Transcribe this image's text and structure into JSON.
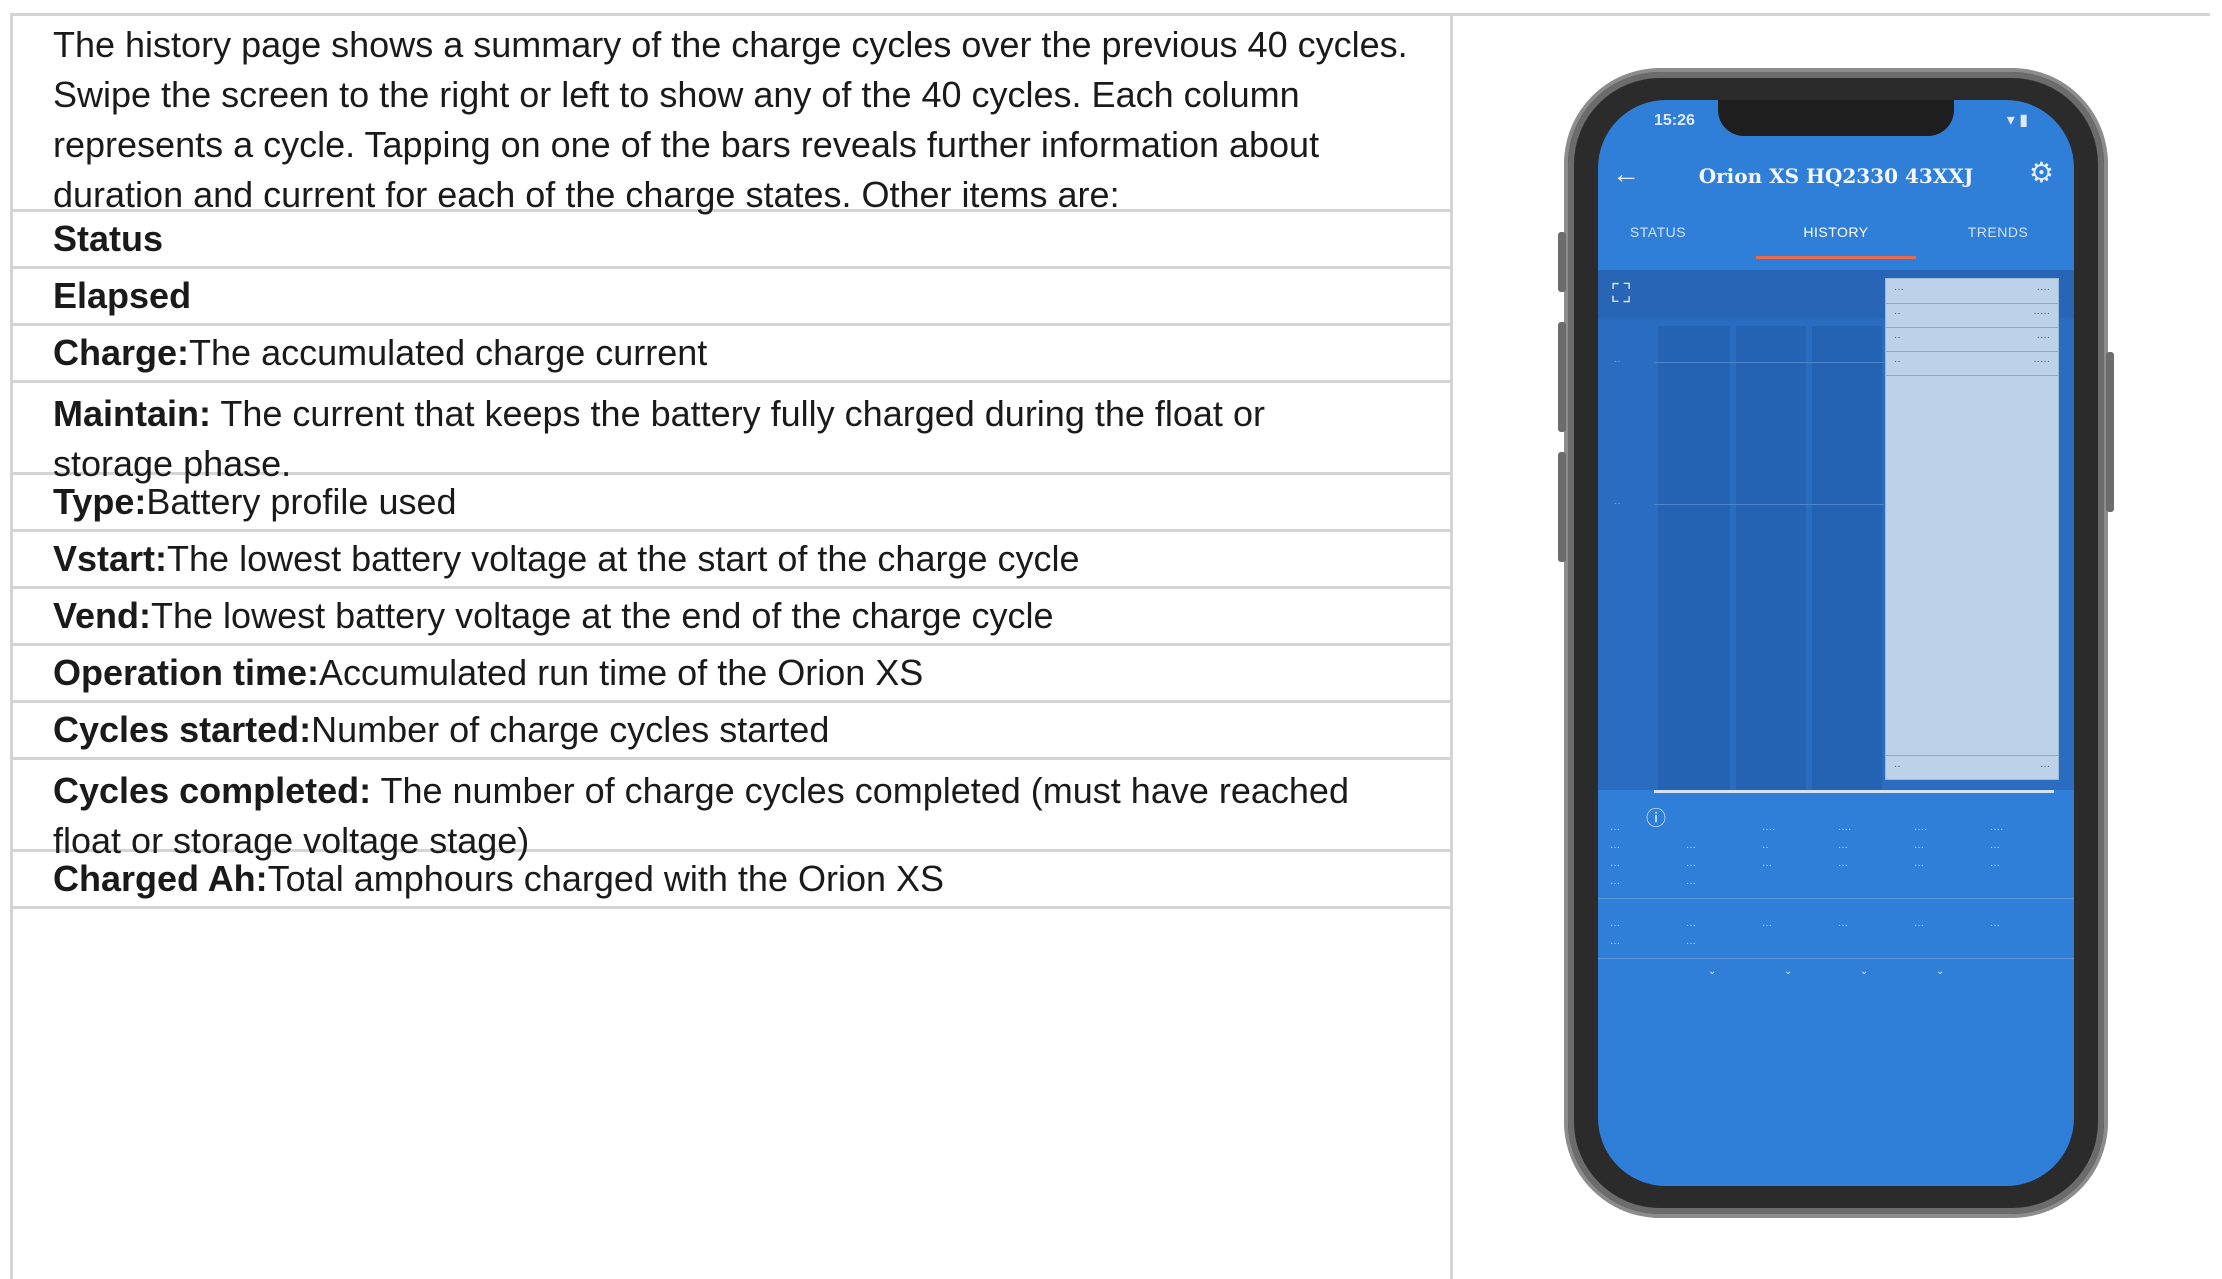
{
  "intro": "The history page shows a summary of the charge cycles over the previous 40 cycles. Swipe the screen to the right or left to show any of the 40 cycles. Each column represents a cycle. Tapping on one of the bars reveals further information about duration and current for each of the charge states. Other items are:",
  "items": [
    {
      "term": "Status",
      "desc": ""
    },
    {
      "term": "Elapsed",
      "desc": ""
    },
    {
      "term": "Charge:",
      "desc": " The accumulated charge current"
    },
    {
      "term": "Maintain:",
      "desc": " The current that keeps the battery fully charged during the float or storage phase."
    },
    {
      "term": "Type:",
      "desc": " Battery profile used"
    },
    {
      "term": "Vstart:",
      "desc": " The lowest battery voltage at the start of the charge cycle"
    },
    {
      "term": "Vend:",
      "desc": " The lowest battery voltage at the end of the charge cycle"
    },
    {
      "term": "Operation time:",
      "desc": " Accumulated run time of the Orion XS"
    },
    {
      "term": "Cycles started:",
      "desc": " Number of charge cycles started"
    },
    {
      "term": "Cycles completed:",
      "desc": " The number of charge cycles completed (must have reached float or storage voltage stage)"
    },
    {
      "term": "Charged Ah:",
      "desc": "Total amphours charged with the Orion XS"
    }
  ],
  "phone": {
    "status_time": "15:26",
    "title": "Orion XS HQ2330 43XXJ",
    "tabs": [
      "STATUS",
      "HISTORY",
      "TRENDS"
    ],
    "active_tab": "HISTORY",
    "colors": {
      "screen": "#2f7fd9",
      "tab_underline": "#e86a4a"
    }
  }
}
